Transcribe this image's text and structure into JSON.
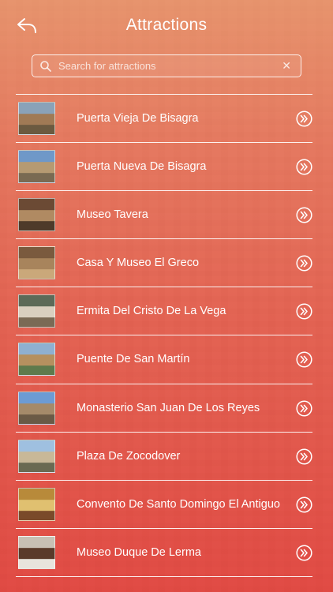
{
  "header": {
    "title": "Attractions",
    "back_icon": "back-arrow-icon"
  },
  "search": {
    "placeholder": "Search for attractions",
    "value": "",
    "search_icon": "search-icon",
    "clear_icon": "clear-icon"
  },
  "attractions": [
    {
      "name": "Puerta Vieja De Bisagra",
      "thumb_colors": [
        "#8aa2b8",
        "#a07a55",
        "#6b5a40"
      ]
    },
    {
      "name": "Puerta Nueva De Bisagra",
      "thumb_colors": [
        "#6f98c8",
        "#b69a72",
        "#7a6a52"
      ]
    },
    {
      "name": "Museo Tavera",
      "thumb_colors": [
        "#6b4a34",
        "#b08a62",
        "#4e3a2a"
      ]
    },
    {
      "name": "Casa Y Museo El Greco",
      "thumb_colors": [
        "#7a5a3e",
        "#a8845c",
        "#caa87a"
      ]
    },
    {
      "name": "Ermita Del Cristo De La Vega",
      "thumb_colors": [
        "#5d6a58",
        "#d9cfbf",
        "#7a6a55"
      ]
    },
    {
      "name": "Puente De San Martín",
      "thumb_colors": [
        "#8fb0d0",
        "#b5905f",
        "#5e7a4c"
      ]
    },
    {
      "name": "Monasterio San Juan De Los Reyes",
      "thumb_colors": [
        "#6c9bd4",
        "#a48a6a",
        "#6a5a46"
      ]
    },
    {
      "name": "Plaza De Zocodover",
      "thumb_colors": [
        "#9fc0e0",
        "#c8b898",
        "#6a6a52"
      ]
    },
    {
      "name": "Convento De Santo Domingo El Antiguo",
      "thumb_colors": [
        "#b88a3a",
        "#e0c070",
        "#7a4a2a"
      ]
    },
    {
      "name": "Museo Duque De Lerma",
      "thumb_colors": [
        "#c8c0b4",
        "#5a3a2a",
        "#e8e4dc"
      ]
    }
  ],
  "row_action_icon": "chevron-right-circle-icon"
}
